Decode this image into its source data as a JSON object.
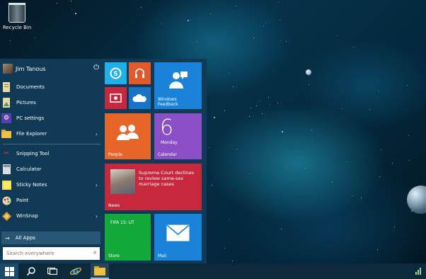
{
  "desktop": {
    "recycle_bin_label": "Recycle Bin"
  },
  "start_menu": {
    "user_name": "Jim Tanous",
    "power_icon": "power-icon",
    "pinned_places": [
      {
        "label": "Documents",
        "icon": "documents-icon"
      },
      {
        "label": "Pictures",
        "icon": "pictures-icon"
      },
      {
        "label": "PC settings",
        "icon": "gear-icon"
      },
      {
        "label": "File Explorer",
        "icon": "folder-icon"
      }
    ],
    "recent_apps": [
      {
        "label": "Snipping Tool",
        "icon": "scissors-icon"
      },
      {
        "label": "Calculator",
        "icon": "calculator-icon"
      },
      {
        "label": "Sticky Notes",
        "icon": "sticky-note-icon"
      },
      {
        "label": "Paint",
        "icon": "paint-icon"
      },
      {
        "label": "WinSnap",
        "icon": "winsnap-icon"
      }
    ],
    "all_apps_label": "All Apps",
    "search_placeholder": "Search everywhere"
  },
  "tiles": {
    "skype": {
      "icon": "skype-icon",
      "color": "#1eb0e8"
    },
    "music": {
      "icon": "headphones-icon",
      "color": "#e05a2c"
    },
    "video": {
      "icon": "video-icon",
      "color": "#c8283e"
    },
    "onedrive": {
      "icon": "cloud-icon",
      "color": "#1a74c6"
    },
    "feedback": {
      "label": "Windows Feedback",
      "icon": "feedback-icon",
      "color": "#1a82d9"
    },
    "people": {
      "label": "People",
      "icon": "people-icon",
      "color": "#e8652a"
    },
    "calendar": {
      "label": "Calendar",
      "day_number": "6",
      "weekday": "Monday",
      "color": "#8b4fc8"
    },
    "news": {
      "label": "News",
      "headline": "Supreme Court declines to review same-sex marriage cases",
      "color": "#c8283e"
    },
    "store": {
      "label": "Store",
      "promo": "FIFA 15: UT",
      "color": "#12a83a"
    },
    "mail": {
      "label": "Mail",
      "icon": "mail-icon",
      "color": "#1a82d9"
    }
  },
  "taskbar": {
    "items": [
      "windows-logo-icon",
      "search-icon",
      "task-view-icon",
      "internet-explorer-icon",
      "file-explorer-icon"
    ]
  }
}
